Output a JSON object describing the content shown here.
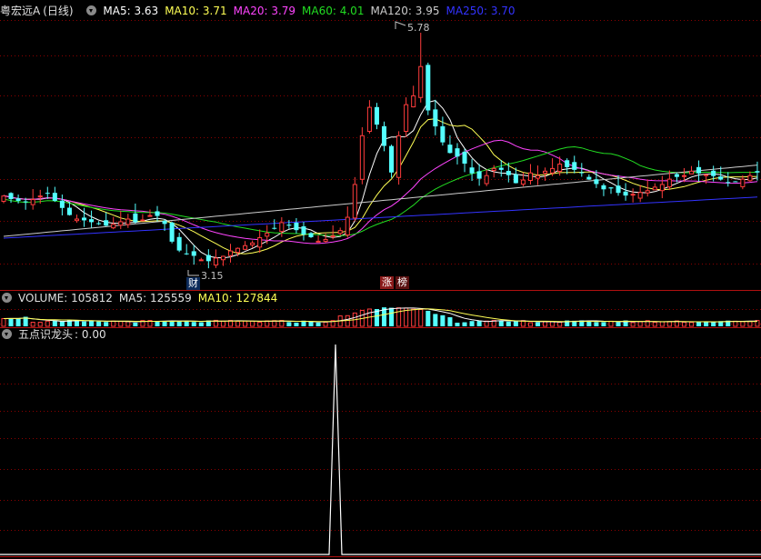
{
  "main_header": {
    "stock_name": "粤宏远A",
    "period": "(日线)",
    "indicators": [
      {
        "label": "MA5: 3.63",
        "color": "#ffffff"
      },
      {
        "label": "MA10: 3.71",
        "color": "#ffff55"
      },
      {
        "label": "MA20: 3.79",
        "color": "#ff44ff"
      },
      {
        "label": "MA60: 4.01",
        "color": "#22dd22"
      },
      {
        "label": "MA120: 3.95",
        "color": "#cccccc"
      },
      {
        "label": "MA250: 3.70",
        "color": "#3333ff"
      }
    ]
  },
  "annotations": {
    "high_label": "5.78",
    "low_label": "3.15",
    "finance_tag": "财",
    "limit_up_tag": "涨",
    "ranking_tag": "榜"
  },
  "volume_header": {
    "title": "VOLUME: 105812",
    "ma5": "MA5: 125559",
    "ma10": "MA10: 127844"
  },
  "indicator_header": {
    "title": "五点识龙头",
    "value": ": 0.00"
  },
  "colors": {
    "up": "#ff3c3c",
    "down": "#54ffff",
    "grid": "#8b0000",
    "text": "#c0c0c0",
    "signal_line": "#ffffff"
  },
  "chart_data": {
    "type": "candlestick",
    "price_high": 5.78,
    "price_low": 3.15,
    "volume_last": 105812,
    "volume_ma5": 125559,
    "volume_ma10": 127844,
    "signal_indicator_current": 0.0
  }
}
